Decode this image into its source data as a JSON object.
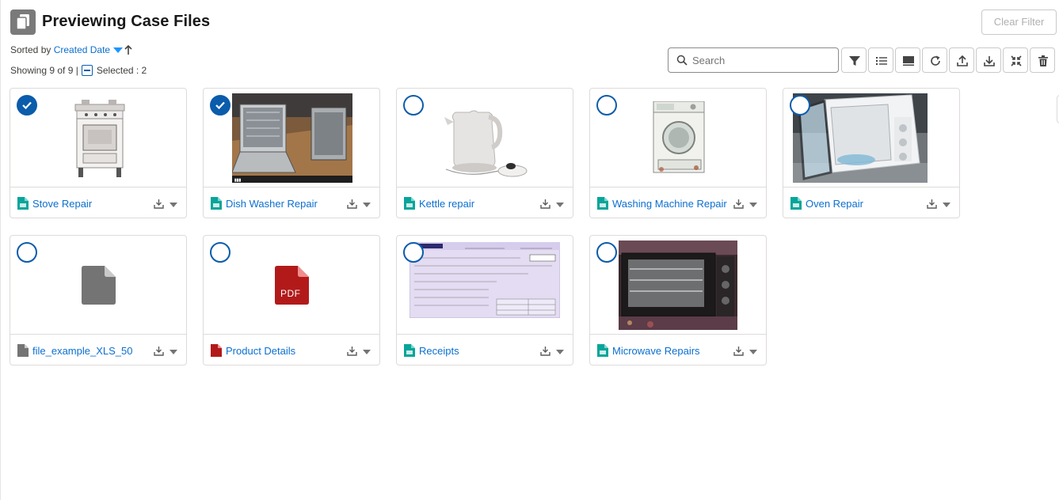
{
  "header": {
    "title": "Previewing Case Files",
    "clear_filter_label": "Clear Filter"
  },
  "sort": {
    "prefix": "Sorted by",
    "field": "Created Date",
    "direction": "ascending"
  },
  "status": {
    "showing": "Showing 9 of 9 |",
    "selected": "Selected : 2"
  },
  "toolbar": {
    "search_placeholder": "Search",
    "buttons": [
      "filter-icon",
      "list-view-icon",
      "tile-view-icon",
      "refresh-icon",
      "upload-icon",
      "download-icon",
      "collapse-icon",
      "delete-icon"
    ]
  },
  "files": [
    {
      "name": "Stove Repair",
      "type": "image",
      "selected": true,
      "thumb": "stove"
    },
    {
      "name": "Dish Washer Repair",
      "type": "image",
      "selected": true,
      "thumb": "dishwasher"
    },
    {
      "name": "Kettle repair",
      "type": "image",
      "selected": false,
      "thumb": "kettle"
    },
    {
      "name": "Washing Machine Repair",
      "type": "image",
      "selected": false,
      "thumb": "washer"
    },
    {
      "name": "Oven Repair",
      "type": "image",
      "selected": false,
      "thumb": "oven"
    },
    {
      "name": "file_example_XLS_50",
      "type": "unknown",
      "selected": false,
      "thumb": "generic"
    },
    {
      "name": "Product Details",
      "type": "pdf",
      "selected": false,
      "thumb": "pdf",
      "thumb_label": "PDF"
    },
    {
      "name": "Receipts",
      "type": "image",
      "selected": false,
      "thumb": "receipt"
    },
    {
      "name": "Microwave Repairs",
      "type": "image",
      "selected": false,
      "thumb": "microwave"
    }
  ],
  "colors": {
    "brand_blue": "#0b5cab",
    "link_blue": "#0b6fd0",
    "image_icon_green": "#06a59a",
    "pdf_red": "#b21a1a",
    "generic_gray": "#7a7a7a"
  }
}
